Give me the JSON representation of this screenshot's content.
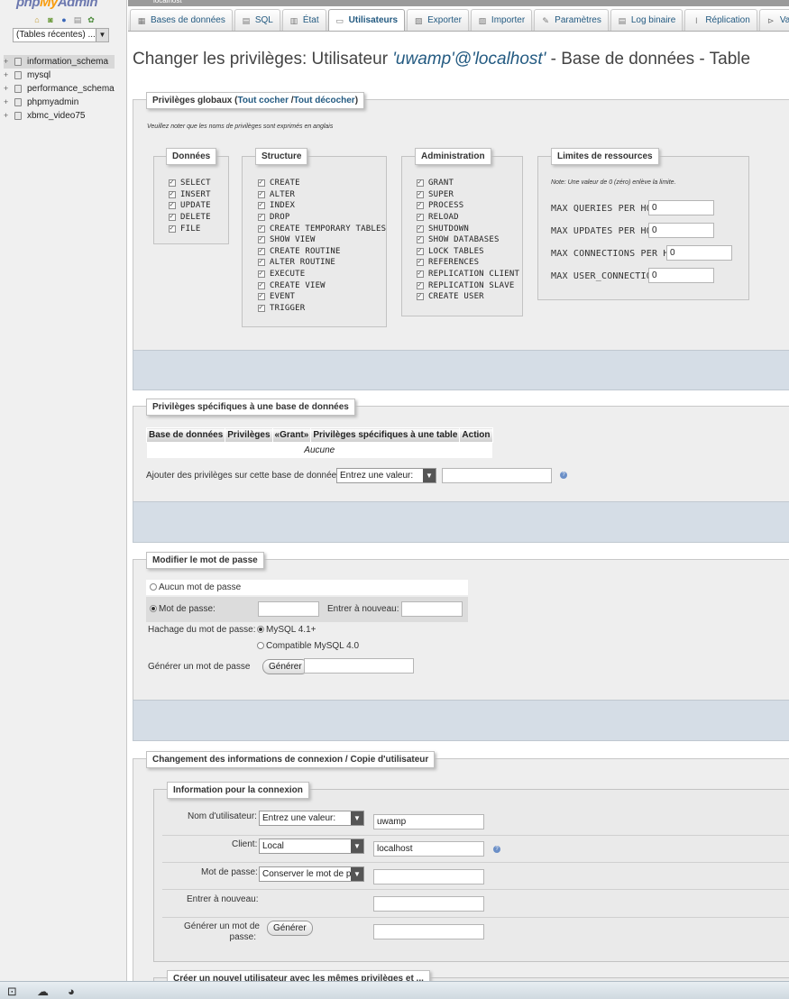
{
  "left": {
    "logo_php": "php",
    "logo_my": "My",
    "logo_admin": "Admin",
    "recent_tables": "(Tables récentes) ...",
    "databases": [
      "information_schema",
      "mysql",
      "performance_schema",
      "phpmyadmin",
      "xbmc_video75"
    ]
  },
  "server": {
    "name": "localhost"
  },
  "tabs": [
    {
      "label": "Bases de données",
      "icon": "database-icon"
    },
    {
      "label": "SQL",
      "icon": "sql-icon"
    },
    {
      "label": "État",
      "icon": "status-icon"
    },
    {
      "label": "Utilisateurs",
      "icon": "users-icon"
    },
    {
      "label": "Exporter",
      "icon": "export-icon"
    },
    {
      "label": "Importer",
      "icon": "import-icon"
    },
    {
      "label": "Paramètres",
      "icon": "wrench-icon"
    },
    {
      "label": "Log binaire",
      "icon": "binlog-icon"
    },
    {
      "label": "Réplication",
      "icon": "replication-icon"
    },
    {
      "label": "Var",
      "icon": "variables-icon"
    }
  ],
  "title": {
    "prefix": "Changer les privilèges: Utilisateur ",
    "user": "'uwamp'@'localhost'",
    "suffix": " - Base de données - Table"
  },
  "global": {
    "legend": "Privilèges globaux (",
    "check_all": "Tout cocher",
    "sep": " /",
    "uncheck_all": "Tout décocher",
    "legend_end": ")",
    "note": "Veuillez noter que les noms de privilèges sont exprimés en anglais",
    "data": {
      "legend": "Données",
      "items": [
        "SELECT",
        "INSERT",
        "UPDATE",
        "DELETE",
        "FILE"
      ]
    },
    "structure": {
      "legend": "Structure",
      "items": [
        "CREATE",
        "ALTER",
        "INDEX",
        "DROP",
        "CREATE TEMPORARY TABLES",
        "SHOW VIEW",
        "CREATE ROUTINE",
        "ALTER ROUTINE",
        "EXECUTE",
        "CREATE VIEW",
        "EVENT",
        "TRIGGER"
      ]
    },
    "admin": {
      "legend": "Administration",
      "items": [
        "GRANT",
        "SUPER",
        "PROCESS",
        "RELOAD",
        "SHUTDOWN",
        "SHOW DATABASES",
        "LOCK TABLES",
        "REFERENCES",
        "REPLICATION CLIENT",
        "REPLICATION SLAVE",
        "CREATE USER"
      ]
    },
    "limits": {
      "legend": "Limites de ressources",
      "note": "Note: Une valeur de 0 (zéro) enlève la limite.",
      "items": [
        {
          "label": "MAX QUERIES PER HOUR",
          "value": "0"
        },
        {
          "label": "MAX UPDATES PER HOUR",
          "value": "0"
        },
        {
          "label": "MAX CONNECTIONS PER HOUR",
          "value": "0"
        },
        {
          "label": "MAX USER_CONNECTIONS",
          "value": "0"
        }
      ]
    }
  },
  "dbpriv": {
    "legend": "Privilèges spécifiques à une base de données",
    "headers": [
      "Base de données",
      "Privilèges",
      "«Grant»",
      "Privilèges spécifiques à une table",
      "Action"
    ],
    "empty": "Aucune",
    "add_label": "Ajouter des privilèges sur cette base de données:",
    "select_value": "Entrez une valeur:"
  },
  "password": {
    "legend": "Modifier le mot de passe",
    "no_password": "Aucun mot de passe",
    "password_label": "Mot de passe:",
    "reenter_label": "Entrer à nouveau:",
    "hash_label": "Hachage du mot de passe:",
    "hash_mysql41": "MySQL 4.1+",
    "hash_mysql40": "Compatible MySQL 4.0",
    "generate_label": "Générer un mot de passe",
    "generate_btn": "Générer"
  },
  "login": {
    "legend": "Changement des informations de connexion / Copie d'utilisateur",
    "info_legend": "Information pour la connexion",
    "username_label": "Nom d'utilisateur:",
    "username_select": "Entrez une valeur:",
    "username_value": "uwamp",
    "host_label": "Client:",
    "host_select": "Local",
    "host_value": "localhost",
    "password_label": "Mot de passe:",
    "password_select": "Conserver le mot de pa",
    "reenter_label": "Entrer à nouveau:",
    "generate_label_1": "Générer un mot de",
    "generate_label_2": "passe:",
    "generate_btn": "Générer",
    "create_legend": "Créer un nouvel utilisateur avec les mêmes privilèges et ..."
  }
}
